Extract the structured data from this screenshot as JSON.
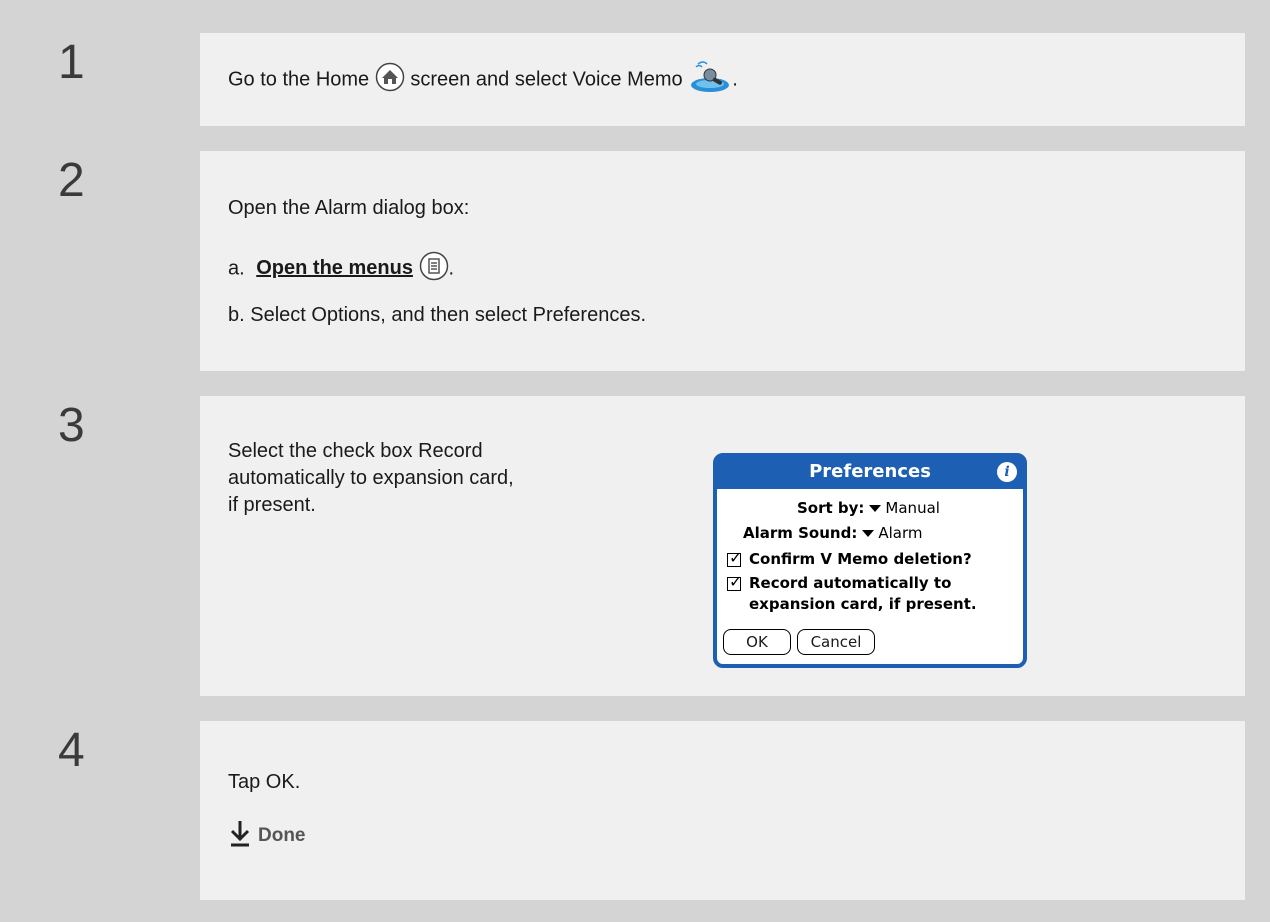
{
  "steps": [
    {
      "number": "1",
      "text_before": "Go to the Home",
      "text_middle": "screen and select Voice Memo",
      "text_end": "."
    },
    {
      "number": "2",
      "intro": "Open the Alarm dialog box:",
      "a_prefix": "a.",
      "a_link": "Open the menus",
      "a_end": ".",
      "b_text": "b.  Select Options, and then select Preferences."
    },
    {
      "number": "3",
      "line1": "Select the check box Record",
      "line2": "automatically to expansion card,",
      "line3": "if present."
    },
    {
      "number": "4",
      "text": "Tap OK.",
      "done_label": "Done"
    }
  ],
  "dialog": {
    "title": "Preferences",
    "info": "i",
    "sort_label": "Sort by:",
    "sort_value": "Manual",
    "alarm_label": "Alarm Sound:",
    "alarm_value": "Alarm",
    "confirm_label": "Confirm V Memo deletion?",
    "record_line1": "Record automatically to",
    "record_line2": "expansion card, if present.",
    "ok_label": "OK",
    "cancel_label": "Cancel"
  },
  "icons": {
    "home": "home-icon",
    "voice_memo": "voice-memo-icon",
    "menu": "menu-icon",
    "done_arrow": "down-arrow-icon"
  },
  "colors": {
    "accent": "#1d5fb3",
    "row_bg": "#f0f0f0",
    "page_bg": "#d4d4d4"
  }
}
